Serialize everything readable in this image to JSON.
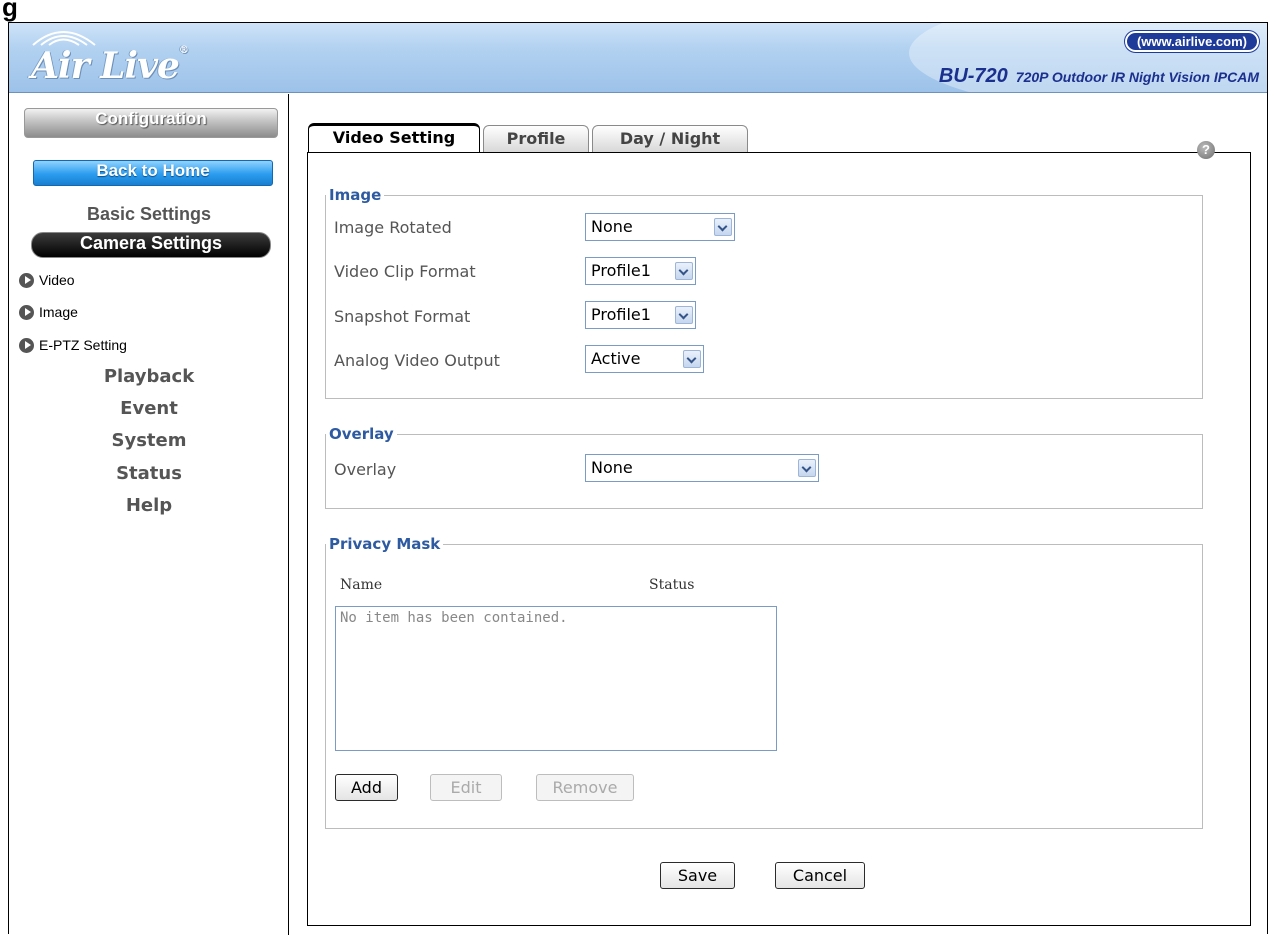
{
  "corner": {
    "glyph": "g"
  },
  "header": {
    "logo": "Air Live",
    "logo_mark": "®",
    "url": "(www.airlive.com)",
    "model": "BU-720",
    "model_desc": "720P Outdoor IR Night Vision IPCAM"
  },
  "sidebar": {
    "config_label": "Configuration",
    "back_home": "Back to Home",
    "basic_settings": "Basic Settings",
    "camera_settings": "Camera Settings",
    "sub_items": [
      "Video",
      "Image",
      "E-PTZ Setting"
    ],
    "menu": [
      "Playback",
      "Event",
      "System",
      "Status",
      "Help"
    ]
  },
  "tabs": [
    "Video Setting",
    "Profile",
    "Day / Night"
  ],
  "help_icon_glyph": "?",
  "image_group": {
    "legend": "Image",
    "rows": [
      {
        "label": "Image Rotated",
        "value": "None"
      },
      {
        "label": "Video Clip Format",
        "value": "Profile1"
      },
      {
        "label": "Snapshot Format",
        "value": "Profile1"
      },
      {
        "label": "Analog Video Output",
        "value": "Active"
      }
    ]
  },
  "overlay_group": {
    "legend": "Overlay",
    "label": "Overlay",
    "value": "None"
  },
  "privacy_group": {
    "legend": "Privacy Mask",
    "col_name": "Name",
    "col_status": "Status",
    "empty_text": "No item has been contained.",
    "add": "Add",
    "edit": "Edit",
    "remove": "Remove"
  },
  "footer": {
    "save": "Save",
    "cancel": "Cancel"
  }
}
